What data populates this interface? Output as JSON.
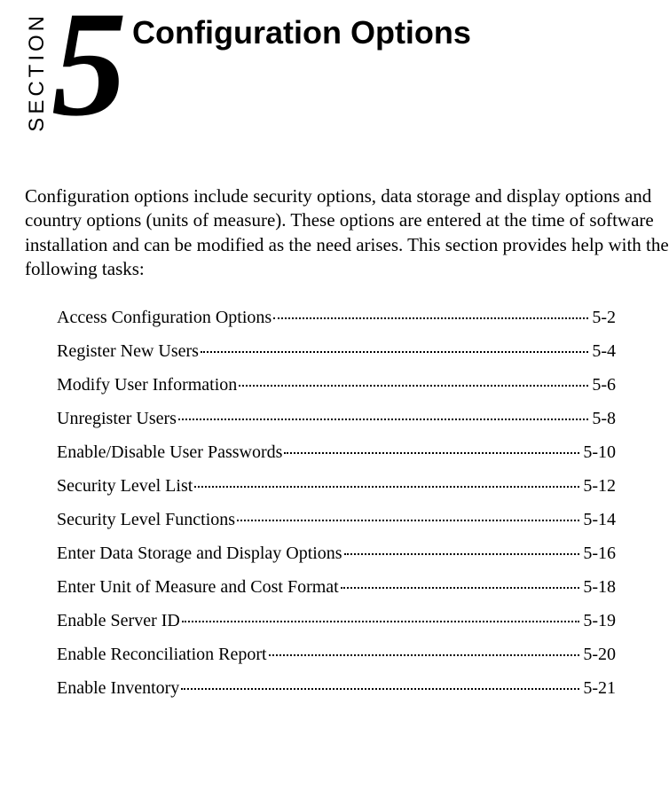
{
  "header": {
    "section_label": "SECTION",
    "number": "5",
    "title": "Configuration Options"
  },
  "intro": "Configuration options include security options, data storage and display options and country options (units of measure). These options are entered at the time of software installation and can be modified as the need arises. This section provides help with the following tasks:",
  "toc": [
    {
      "label": "Access Configuration Options",
      "page": "5-2"
    },
    {
      "label": "Register New Users",
      "page": "5-4"
    },
    {
      "label": "Modify User Information",
      "page": "5-6"
    },
    {
      "label": "Unregister Users",
      "page": "5-8"
    },
    {
      "label": "Enable/Disable User Passwords",
      "page": "5-10"
    },
    {
      "label": "Security Level List",
      "page": "5-12"
    },
    {
      "label": "Security Level Functions",
      "page": "5-14"
    },
    {
      "label": "Enter Data Storage and Display Options",
      "page": "5-16"
    },
    {
      "label": "Enter Unit of Measure and Cost Format",
      "page": "5-18"
    },
    {
      "label": "Enable Server ID",
      "page": "5-19"
    },
    {
      "label": "Enable Reconciliation Report",
      "page": "5-20"
    },
    {
      "label": "Enable Inventory",
      "page": "5-21"
    }
  ]
}
